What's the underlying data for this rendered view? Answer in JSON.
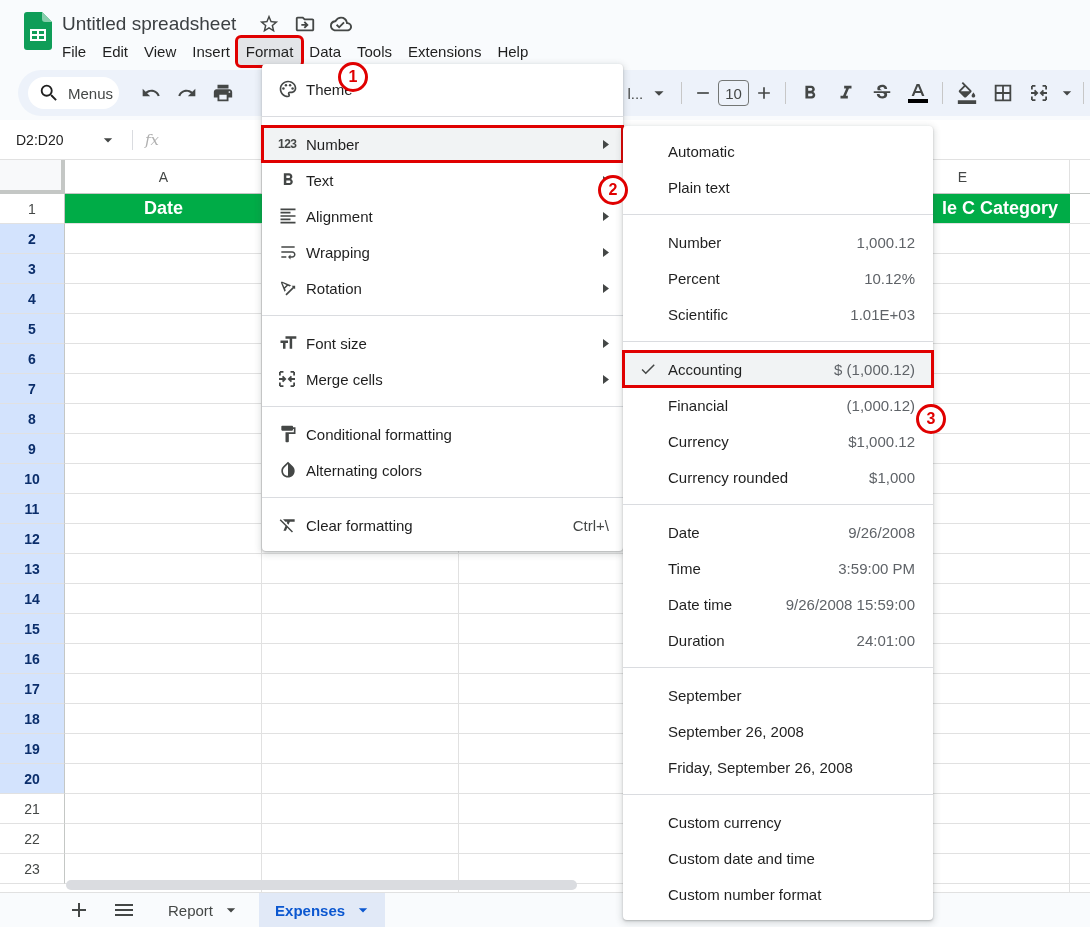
{
  "document": {
    "title": "Untitled spreadsheet"
  },
  "menubar": [
    {
      "label": "File",
      "selected": false,
      "annotated": false
    },
    {
      "label": "Edit",
      "selected": false,
      "annotated": false
    },
    {
      "label": "View",
      "selected": false,
      "annotated": false
    },
    {
      "label": "Insert",
      "selected": false,
      "annotated": false
    },
    {
      "label": "Format",
      "selected": true,
      "annotated": true
    },
    {
      "label": "Data",
      "selected": false,
      "annotated": false
    },
    {
      "label": "Tools",
      "selected": false,
      "annotated": false
    },
    {
      "label": "Extensions",
      "selected": false,
      "annotated": false
    },
    {
      "label": "Help",
      "selected": false,
      "annotated": false
    }
  ],
  "toolbar": {
    "search_label": "Menus",
    "font_fragment": "l...",
    "font_size": "10"
  },
  "formula_bar": {
    "name_box": "D2:D20",
    "fx": "fx"
  },
  "sheet": {
    "columns": [
      {
        "label": "A",
        "title": "Date"
      },
      {
        "label": "E",
        "title": "le C Category"
      }
    ],
    "rows": [
      {
        "label": "1",
        "selected": false
      },
      {
        "label": "2",
        "selected": true
      },
      {
        "label": "3",
        "selected": true
      },
      {
        "label": "4",
        "selected": true
      },
      {
        "label": "5",
        "selected": true
      },
      {
        "label": "6",
        "selected": true
      },
      {
        "label": "7",
        "selected": true
      },
      {
        "label": "8",
        "selected": true
      },
      {
        "label": "9",
        "selected": true
      },
      {
        "label": "10",
        "selected": true
      },
      {
        "label": "11",
        "selected": true
      },
      {
        "label": "12",
        "selected": true
      },
      {
        "label": "13",
        "selected": true
      },
      {
        "label": "14",
        "selected": true
      },
      {
        "label": "15",
        "selected": true
      },
      {
        "label": "16",
        "selected": true
      },
      {
        "label": "17",
        "selected": true
      },
      {
        "label": "18",
        "selected": true
      },
      {
        "label": "19",
        "selected": true
      },
      {
        "label": "20",
        "selected": true
      },
      {
        "label": "21",
        "selected": false
      },
      {
        "label": "22",
        "selected": false
      },
      {
        "label": "23",
        "selected": false
      }
    ]
  },
  "sheet_tabs": [
    {
      "label": "Report",
      "selected": false
    },
    {
      "label": "Expenses",
      "selected": true
    }
  ],
  "format_menu": {
    "items": [
      {
        "kind": "item",
        "label": "Theme",
        "highlighted": false,
        "has_submenu": false,
        "annotated": false
      },
      {
        "kind": "divider"
      },
      {
        "kind": "item",
        "label": "Number",
        "icon_text": "123",
        "highlighted": true,
        "has_submenu": true,
        "annotated": true
      },
      {
        "kind": "item",
        "label": "Text",
        "highlighted": false,
        "has_submenu": true,
        "annotated": false
      },
      {
        "kind": "item",
        "label": "Alignment",
        "highlighted": false,
        "has_submenu": true,
        "annotated": false
      },
      {
        "kind": "item",
        "label": "Wrapping",
        "highlighted": false,
        "has_submenu": true,
        "annotated": false
      },
      {
        "kind": "item",
        "label": "Rotation",
        "highlighted": false,
        "has_submenu": true,
        "annotated": false
      },
      {
        "kind": "divider"
      },
      {
        "kind": "item",
        "label": "Font size",
        "highlighted": false,
        "has_submenu": true,
        "annotated": false
      },
      {
        "kind": "item",
        "label": "Merge cells",
        "highlighted": false,
        "has_submenu": true,
        "annotated": false
      },
      {
        "kind": "divider"
      },
      {
        "kind": "item",
        "label": "Conditional formatting",
        "highlighted": false,
        "has_submenu": false,
        "annotated": false
      },
      {
        "kind": "item",
        "label": "Alternating colors",
        "highlighted": false,
        "has_submenu": false,
        "annotated": false
      },
      {
        "kind": "divider"
      },
      {
        "kind": "item",
        "label": "Clear formatting",
        "shortcut": "Ctrl+\\",
        "highlighted": false,
        "has_submenu": false,
        "annotated": false
      }
    ]
  },
  "number_submenu": {
    "items": [
      {
        "kind": "item",
        "label": "Automatic",
        "checked": false,
        "highlighted": false,
        "annotated": false
      },
      {
        "kind": "item",
        "label": "Plain text",
        "checked": false,
        "highlighted": false,
        "annotated": false
      },
      {
        "kind": "divider"
      },
      {
        "kind": "item",
        "label": "Number",
        "example": "1,000.12",
        "checked": false,
        "highlighted": false,
        "annotated": false
      },
      {
        "kind": "item",
        "label": "Percent",
        "example": "10.12%",
        "checked": false,
        "highlighted": false,
        "annotated": false
      },
      {
        "kind": "item",
        "label": "Scientific",
        "example": "1.01E+03",
        "checked": false,
        "highlighted": false,
        "annotated": false
      },
      {
        "kind": "divider"
      },
      {
        "kind": "item",
        "label": "Accounting",
        "example": "$ (1,000.12)",
        "checked": true,
        "highlighted": true,
        "annotated": true
      },
      {
        "kind": "item",
        "label": "Financial",
        "example": "(1,000.12)",
        "checked": false,
        "highlighted": false,
        "annotated": false
      },
      {
        "kind": "item",
        "label": "Currency",
        "example": "$1,000.12",
        "checked": false,
        "highlighted": false,
        "annotated": false
      },
      {
        "kind": "item",
        "label": "Currency rounded",
        "example": "$1,000",
        "checked": false,
        "highlighted": false,
        "annotated": false
      },
      {
        "kind": "divider"
      },
      {
        "kind": "item",
        "label": "Date",
        "example": "9/26/2008",
        "checked": false,
        "highlighted": false,
        "annotated": false
      },
      {
        "kind": "item",
        "label": "Time",
        "example": "3:59:00 PM",
        "checked": false,
        "highlighted": false,
        "annotated": false
      },
      {
        "kind": "item",
        "label": "Date time",
        "example": "9/26/2008 15:59:00",
        "checked": false,
        "highlighted": false,
        "annotated": false
      },
      {
        "kind": "item",
        "label": "Duration",
        "example": "24:01:00",
        "checked": false,
        "highlighted": false,
        "annotated": false
      },
      {
        "kind": "divider"
      },
      {
        "kind": "item",
        "label": "September",
        "checked": false,
        "highlighted": false,
        "annotated": false
      },
      {
        "kind": "item",
        "label": "September 26, 2008",
        "checked": false,
        "highlighted": false,
        "annotated": false
      },
      {
        "kind": "item",
        "label": "Friday, September 26, 2008",
        "checked": false,
        "highlighted": false,
        "annotated": false
      },
      {
        "kind": "divider"
      },
      {
        "kind": "item",
        "label": "Custom currency",
        "checked": false,
        "highlighted": false,
        "annotated": false
      },
      {
        "kind": "item",
        "label": "Custom date and time",
        "checked": false,
        "highlighted": false,
        "annotated": false
      },
      {
        "kind": "item",
        "label": "Custom number format",
        "checked": false,
        "highlighted": false,
        "annotated": false
      }
    ]
  },
  "callouts": [
    {
      "label": "1"
    },
    {
      "label": "2"
    },
    {
      "label": "3"
    }
  ]
}
